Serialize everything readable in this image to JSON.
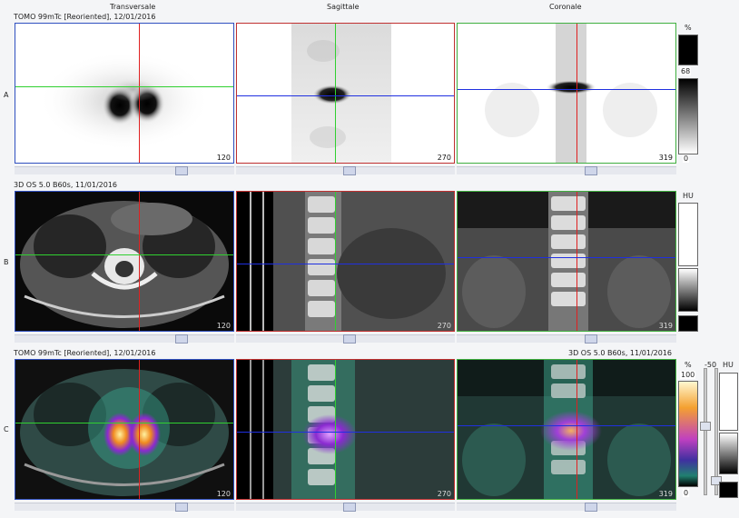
{
  "columns": {
    "transversale": "Transversale",
    "sagittale": "Sagittale",
    "coronale": "Coronale"
  },
  "rows": {
    "a": {
      "label": "A",
      "header": "TOMO 99mTc [Reoriented], 12/01/2016"
    },
    "b": {
      "label": "B",
      "header": "3D OS 5.0 B60s, 11/01/2016"
    },
    "c": {
      "label": "C",
      "header_left": "TOMO 99mTc [Reoriented], 12/01/2016",
      "header_right": "3D OS 5.0 B60s, 11/01/2016"
    }
  },
  "slice_numbers": {
    "transversale": "120",
    "sagittale": "270",
    "coronale": "319"
  },
  "colorbars": {
    "a": {
      "unit": "%",
      "value": "68",
      "min": "0"
    },
    "b": {
      "unit": "HU"
    },
    "c": {
      "unit_pct": "%",
      "max": "100",
      "min": "0",
      "window": "-50",
      "unit_hu": "HU"
    }
  },
  "colors": {
    "crosshair_red": "#e02020",
    "crosshair_green": "#30d030",
    "crosshair_blue": "#2030e0",
    "frame_blue": "#3050c0",
    "frame_red": "#c03030",
    "frame_green": "#40b040"
  }
}
